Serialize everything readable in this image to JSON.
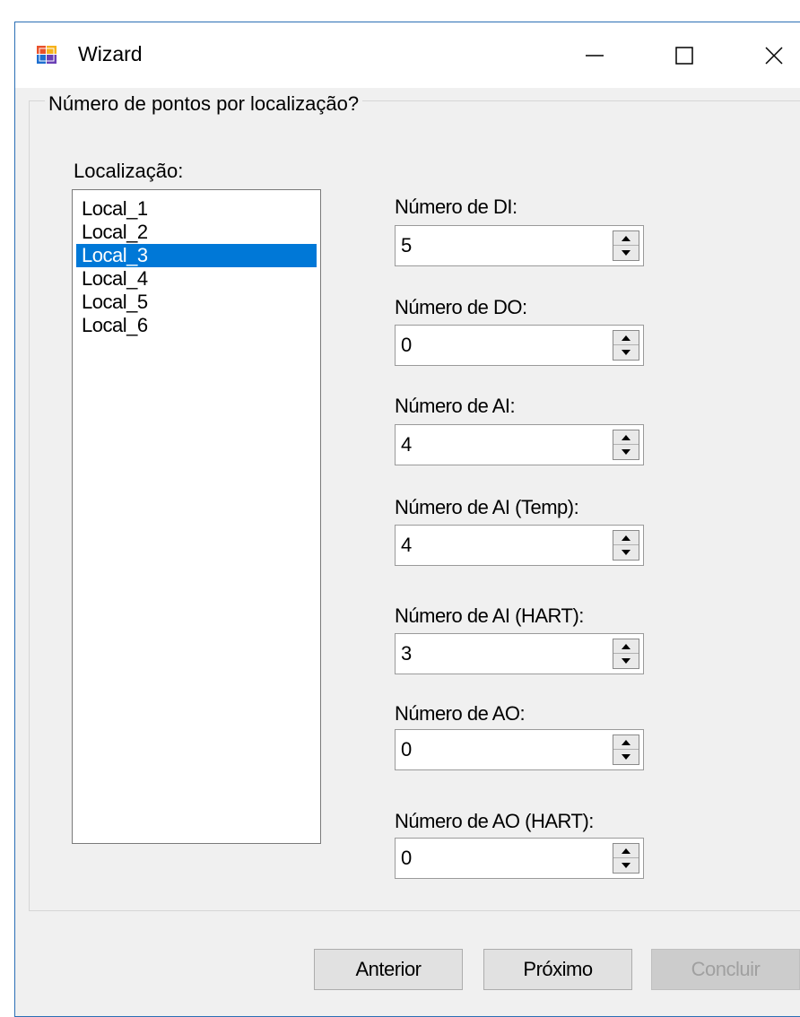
{
  "window": {
    "title": "Wizard"
  },
  "group": {
    "legend": "Número de pontos por localização?"
  },
  "location": {
    "label": "Localização:",
    "items": [
      "Local_1",
      "Local_2",
      "Local_3",
      "Local_4",
      "Local_5",
      "Local_6"
    ],
    "selected": "Local_3"
  },
  "fields": [
    {
      "label": "Número de DI:",
      "value": "5"
    },
    {
      "label": "Número de DO:",
      "value": "0"
    },
    {
      "label": "Número de AI:",
      "value": "4"
    },
    {
      "label": "Número de AI (Temp):",
      "value": "4"
    },
    {
      "label": "Número de AI (HART):",
      "value": "3"
    },
    {
      "label": "Número de AO:",
      "value": "0"
    },
    {
      "label": "Número de AO (HART):",
      "value": "0"
    }
  ],
  "buttons": {
    "previous": "Anterior",
    "next": "Próximo",
    "finish": "Concluir"
  },
  "colors": {
    "selection": "#0078d7",
    "window_border": "#2b6fb5"
  }
}
